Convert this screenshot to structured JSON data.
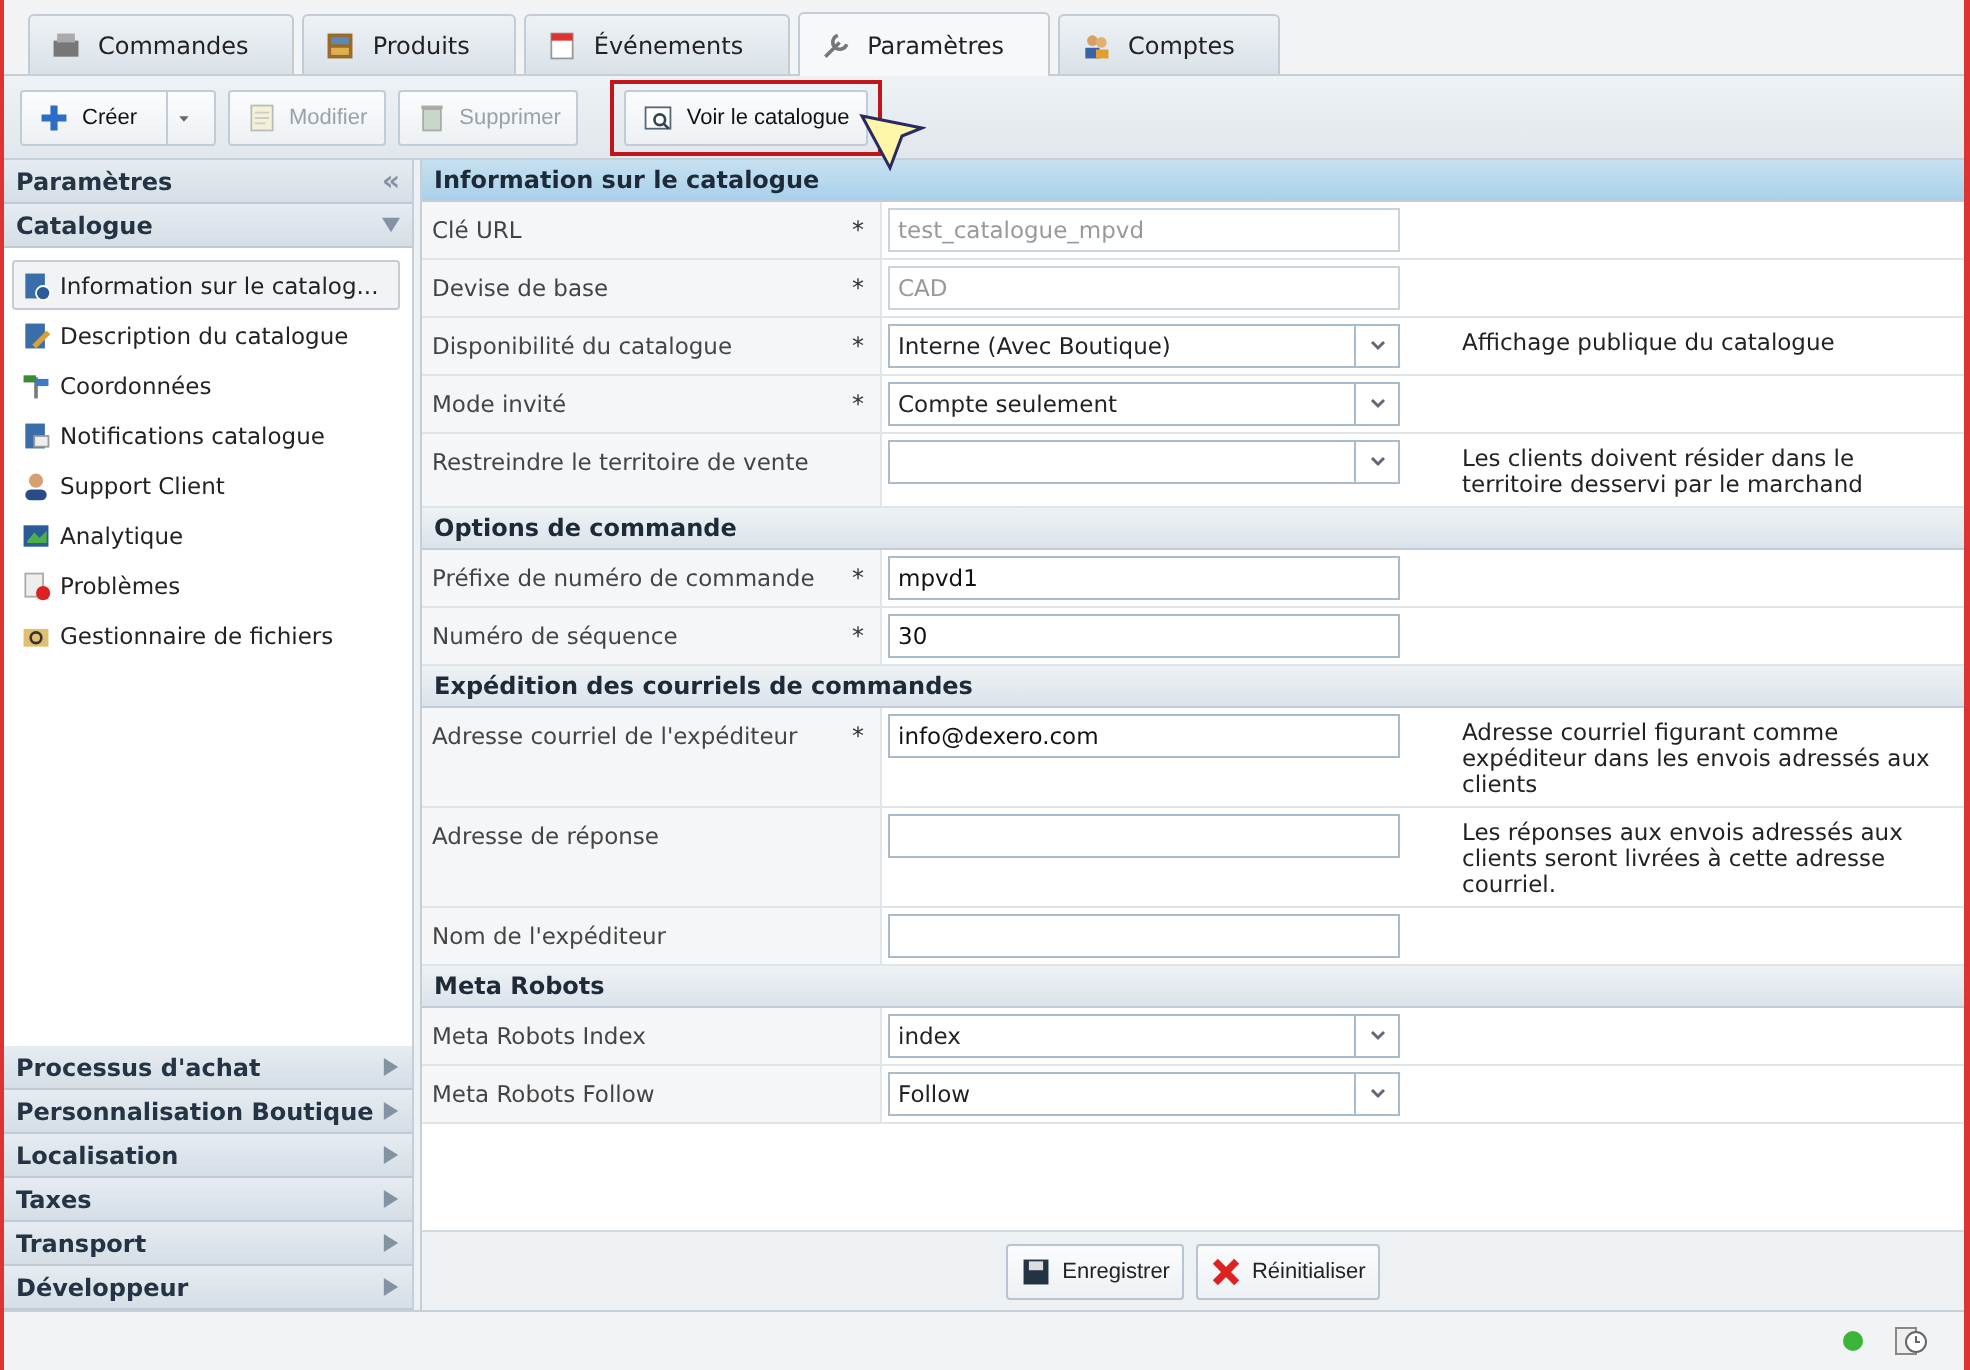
{
  "tabs": [
    {
      "label": "Commandes",
      "selected": false
    },
    {
      "label": "Produits",
      "selected": false
    },
    {
      "label": "Événements",
      "selected": false
    },
    {
      "label": "Paramètres",
      "selected": true
    },
    {
      "label": "Comptes",
      "selected": false
    }
  ],
  "toolbar": [
    {
      "label": "Créer",
      "kind": "split",
      "disabled": false,
      "highlighted": false
    },
    {
      "label": "Modifier",
      "kind": "button",
      "disabled": true,
      "highlighted": false
    },
    {
      "label": "Supprimer",
      "kind": "button",
      "disabled": true,
      "highlighted": false
    },
    {
      "label": "Voir le catalogue",
      "kind": "button",
      "disabled": false,
      "highlighted": true
    }
  ],
  "sidebar": {
    "title": "Paramètres",
    "collapse": "«",
    "sections": [
      {
        "label": "Catalogue",
        "expanded": true,
        "items": [
          {
            "label": "Information sur le catalog...",
            "selected": true
          },
          {
            "label": "Description du catalogue",
            "selected": false
          },
          {
            "label": "Coordonnées",
            "selected": false
          },
          {
            "label": "Notifications catalogue",
            "selected": false
          },
          {
            "label": "Support Client",
            "selected": false
          },
          {
            "label": "Analytique",
            "selected": false
          },
          {
            "label": "Problèmes",
            "selected": false
          },
          {
            "label": "Gestionnaire de fichiers",
            "selected": false
          }
        ]
      },
      {
        "label": "Processus d'achat",
        "expanded": false
      },
      {
        "label": "Personnalisation Boutique",
        "expanded": false
      },
      {
        "label": "Localisation",
        "expanded": false
      },
      {
        "label": "Taxes",
        "expanded": false
      },
      {
        "label": "Transport",
        "expanded": false
      },
      {
        "label": "Développeur",
        "expanded": false
      }
    ]
  },
  "form": [
    {
      "title": "Information sur le catalogue",
      "kind": "main",
      "fields": [
        {
          "label": "Clé URL",
          "required": true,
          "kind": "text",
          "value": "test_catalogue_mpvd",
          "disabled": true
        },
        {
          "label": "Devise de base",
          "required": true,
          "kind": "text",
          "value": "CAD",
          "disabled": true
        },
        {
          "label": "Disponibilité du catalogue",
          "required": true,
          "kind": "select",
          "value": "Interne (Avec Boutique)",
          "help": "Affichage publique du catalogue"
        },
        {
          "label": "Mode invité",
          "required": true,
          "kind": "select",
          "value": "Compte seulement"
        },
        {
          "label": "Restreindre le territoire de vente",
          "kind": "select",
          "help": "Les clients doivent résider dans le territoire desservi par le marchand"
        }
      ]
    },
    {
      "title": "Options de commande",
      "kind": "sub",
      "fields": [
        {
          "label": "Préfixe de numéro de commande",
          "required": true,
          "kind": "text",
          "value": "mpvd1",
          "disabled": false
        },
        {
          "label": "Numéro de séquence",
          "required": true,
          "kind": "text",
          "value": "30",
          "disabled": false
        }
      ]
    },
    {
      "title": "Expédition des courriels de commandes",
      "kind": "sub",
      "fields": [
        {
          "label": "Adresse courriel de l'expéditeur",
          "required": true,
          "kind": "text",
          "value": "info@dexero.com",
          "disabled": false,
          "help": "Adresse courriel figurant comme expéditeur dans les envois adressés aux clients"
        },
        {
          "label": "Adresse de réponse",
          "kind": "text",
          "help": "Les réponses aux envois adressés aux clients seront livrées à cette adresse courriel."
        },
        {
          "label": "Nom de l'expéditeur",
          "kind": "text"
        }
      ]
    },
    {
      "title": "Meta Robots",
      "kind": "sub",
      "fields": [
        {
          "label": "Meta Robots Index",
          "kind": "select",
          "value": "index"
        },
        {
          "label": "Meta Robots Follow",
          "kind": "select",
          "value": "Follow"
        }
      ]
    }
  ],
  "required_mark": "*",
  "footer": [
    {
      "label": "Enregistrer"
    },
    {
      "label": "Réinitialiser"
    }
  ],
  "status": {
    "online": true
  }
}
